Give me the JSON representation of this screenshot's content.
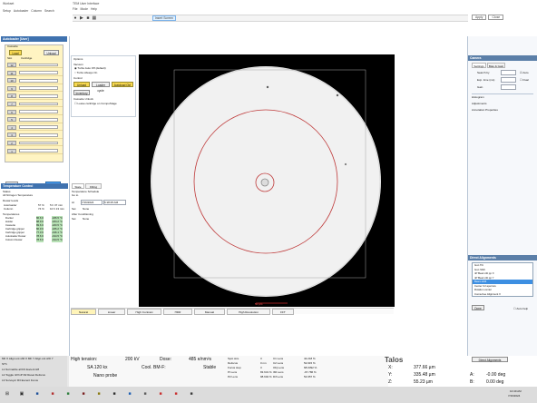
{
  "window": {
    "title": "TEM User Interface",
    "app_title": "Workset",
    "menu": [
      "Setup",
      "Autoloader",
      "Column",
      "Search"
    ],
    "top_menu": [
      "File",
      "Mode",
      "Help"
    ]
  },
  "toolbar": {
    "insert_screen": "Insert Screen",
    "apply": "Apply",
    "close": "Close"
  },
  "autoloader": {
    "title": "Autoloader [User]",
    "cassette_label": "Cassette",
    "load_btn": "Load",
    "unload_btn": "Unload",
    "slot_label": "Slot",
    "cartridge_label": "Cartridge",
    "rows": [
      "12",
      "11",
      "10",
      "9",
      "8",
      "7",
      "6",
      "5",
      "4",
      "3",
      "2",
      "1"
    ],
    "edit_slot_state": "Edit Slot State",
    "load_bottom": "Load",
    "unload_bottom": "Unload",
    "status_label": "Status"
  },
  "options": {
    "title": "Options",
    "vacuum_title": "Vacuum",
    "vacuum_option_a": "Turbo Auto Off (default)",
    "vacuum_option_b": "Turbo Always On",
    "control_title": "Control",
    "control_buttons": [
      "Unload",
      "Loader cycle",
      "Autoload Ctrl"
    ],
    "inventory": "Inventory",
    "cassette_unlock": "Cassette Unlock",
    "leave_cartridge": "Leave cartridge on CompuStage"
  },
  "temperature": {
    "title": "Temperature Control",
    "status_title": "Status",
    "all_nitrogen": "All Nitrogen Temperature",
    "dewar_levels_title": "Dewar levels",
    "dewar_autoloader": "Autoloader",
    "dewar_autoloader_val": "57 %",
    "dewar_autoloader_time": "5 h 37 min",
    "dewar_column": "Column",
    "dewar_column_val": "74 %",
    "dewar_column_time": "10 h 13 min",
    "temperatures_title": "Temperatures",
    "temp_rows": [
      {
        "name": "Docker",
        "k": "86.6 K",
        "c": "-186.5 °C"
      },
      {
        "name": "Holder",
        "k": "88.9 K",
        "c": "-184.2 °C"
      },
      {
        "name": "Cassette",
        "k": "89.6 K",
        "c": "-183.5 °C"
      },
      {
        "name": "Cartridge gripper",
        "k": "86.9 K",
        "c": "-186.2 °C"
      },
      {
        "name": "Cartridge gripper",
        "k": "77.0 K",
        "c": "-196.1 °C"
      },
      {
        "name": "Autoloader Dewar",
        "k": "78.6 K",
        "c": "-194.5 °C"
      },
      {
        "name": "Column Dewar",
        "k": "78.6 K",
        "c": "-194.5 °C"
      }
    ],
    "tab_state": "State",
    "tab_filling": "Filling",
    "temperature_schedule": "Temperature Schedule",
    "go_to": "Go to",
    "at_label": "At",
    "at_date": "7/16/2024",
    "at_time": "6:18:25 AM",
    "set_label": "Set",
    "set_value": "None",
    "after_conditioning": "After Conditioning",
    "after_set_label": "Set",
    "after_set_value": "None"
  },
  "viewer": {
    "scale_label": "50 µm"
  },
  "view_tabs": [
    "Natural",
    "Linear",
    "High Contrast",
    "HDR",
    "Manual",
    "High Resolution",
    "FFT"
  ],
  "camera_panel": {
    "title": "Camera",
    "tab_settings": "Settings",
    "tab_bias": "Bias & Gain",
    "search_by": "Search by",
    "exp_time": "Exp. time (ms)",
    "gain": "Gain",
    "auto": "Auto",
    "dual": "Dual",
    "histogram": "Histogram",
    "adjustments": "Adjustments",
    "annotation": "Annotation Properties"
  },
  "direct_alignments": {
    "title": "Direct Alignments",
    "items": [
      "Gun Tilt",
      "Gun Shift",
      "nP Beam tilt pp X",
      "nP Beam tilt pp Y",
      "Beam shift",
      "Center C2 aperture",
      "Rotation center",
      "Coma-free Alignment X"
    ],
    "selected_index": 4,
    "done_btn": "Done",
    "auto_help": "Auto help"
  },
  "bottom_left": {
    "lines": [
      "MF X  Align unt shft X    MF Y  Align unt shft Y",
      "STh",
      "L1    Normalize all   R1    Eucent H8",
      "L2    Toggle nP/mP    R2    Reset Defocus",
      "L3    Surveyor        R3    Eucent Focus"
    ]
  },
  "status": {
    "high_tension_label": "High tension:",
    "high_tension_val": "200 kV",
    "dose_label": "Dose:",
    "dose_val": "485 e/nm²s",
    "mode": "SA 120 kx",
    "cool_label": "Cool. BM-F:",
    "cool_val": "Stable",
    "probe": "Nano probe",
    "lens_rows": [
      [
        "Spot size",
        "3",
        "C1 Lens",
        "42.218 %"
      ],
      [
        "Defocus",
        "0 nm",
        "C2 Lens",
        "52.915 %"
      ],
      [
        "Focus step",
        "3",
        "Obj Lens",
        "68.0392 %"
      ],
      [
        "PI Lens",
        "83.631 %",
        "IMI Lens",
        "-97.786 %"
      ],
      [
        "P2 Lens",
        "98.602 %",
        "Dif Lens",
        "54.957 %"
      ]
    ],
    "brand": "Talos",
    "x_label": "X:",
    "x_val": "377.66 µm",
    "y_label": "Y:",
    "y_val": "335.48 µm",
    "z_label": "Z:",
    "z_val": "55.23 µm",
    "a_label": "A:",
    "a_val": "-0.00 deg",
    "b_label": "B:",
    "b_val": "0.00 deg",
    "direct_align": "Direct Alignments"
  },
  "taskbar": {
    "time": "10:49 AM",
    "date": "7/16/2024"
  }
}
